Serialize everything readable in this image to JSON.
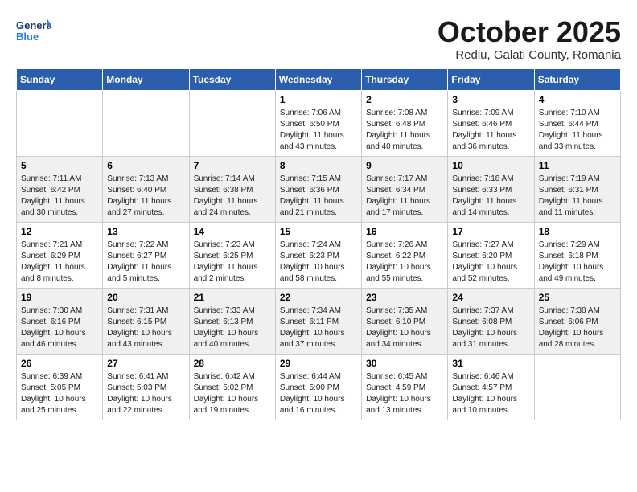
{
  "header": {
    "logo_text_general": "General",
    "logo_text_blue": "Blue",
    "month": "October 2025",
    "location": "Rediu, Galati County, Romania"
  },
  "weekdays": [
    "Sunday",
    "Monday",
    "Tuesday",
    "Wednesday",
    "Thursday",
    "Friday",
    "Saturday"
  ],
  "weeks": [
    [
      {
        "day": "",
        "info": ""
      },
      {
        "day": "",
        "info": ""
      },
      {
        "day": "",
        "info": ""
      },
      {
        "day": "1",
        "info": "Sunrise: 7:06 AM\nSunset: 6:50 PM\nDaylight: 11 hours\nand 43 minutes."
      },
      {
        "day": "2",
        "info": "Sunrise: 7:08 AM\nSunset: 6:48 PM\nDaylight: 11 hours\nand 40 minutes."
      },
      {
        "day": "3",
        "info": "Sunrise: 7:09 AM\nSunset: 6:46 PM\nDaylight: 11 hours\nand 36 minutes."
      },
      {
        "day": "4",
        "info": "Sunrise: 7:10 AM\nSunset: 6:44 PM\nDaylight: 11 hours\nand 33 minutes."
      }
    ],
    [
      {
        "day": "5",
        "info": "Sunrise: 7:11 AM\nSunset: 6:42 PM\nDaylight: 11 hours\nand 30 minutes."
      },
      {
        "day": "6",
        "info": "Sunrise: 7:13 AM\nSunset: 6:40 PM\nDaylight: 11 hours\nand 27 minutes."
      },
      {
        "day": "7",
        "info": "Sunrise: 7:14 AM\nSunset: 6:38 PM\nDaylight: 11 hours\nand 24 minutes."
      },
      {
        "day": "8",
        "info": "Sunrise: 7:15 AM\nSunset: 6:36 PM\nDaylight: 11 hours\nand 21 minutes."
      },
      {
        "day": "9",
        "info": "Sunrise: 7:17 AM\nSunset: 6:34 PM\nDaylight: 11 hours\nand 17 minutes."
      },
      {
        "day": "10",
        "info": "Sunrise: 7:18 AM\nSunset: 6:33 PM\nDaylight: 11 hours\nand 14 minutes."
      },
      {
        "day": "11",
        "info": "Sunrise: 7:19 AM\nSunset: 6:31 PM\nDaylight: 11 hours\nand 11 minutes."
      }
    ],
    [
      {
        "day": "12",
        "info": "Sunrise: 7:21 AM\nSunset: 6:29 PM\nDaylight: 11 hours\nand 8 minutes."
      },
      {
        "day": "13",
        "info": "Sunrise: 7:22 AM\nSunset: 6:27 PM\nDaylight: 11 hours\nand 5 minutes."
      },
      {
        "day": "14",
        "info": "Sunrise: 7:23 AM\nSunset: 6:25 PM\nDaylight: 11 hours\nand 2 minutes."
      },
      {
        "day": "15",
        "info": "Sunrise: 7:24 AM\nSunset: 6:23 PM\nDaylight: 10 hours\nand 58 minutes."
      },
      {
        "day": "16",
        "info": "Sunrise: 7:26 AM\nSunset: 6:22 PM\nDaylight: 10 hours\nand 55 minutes."
      },
      {
        "day": "17",
        "info": "Sunrise: 7:27 AM\nSunset: 6:20 PM\nDaylight: 10 hours\nand 52 minutes."
      },
      {
        "day": "18",
        "info": "Sunrise: 7:29 AM\nSunset: 6:18 PM\nDaylight: 10 hours\nand 49 minutes."
      }
    ],
    [
      {
        "day": "19",
        "info": "Sunrise: 7:30 AM\nSunset: 6:16 PM\nDaylight: 10 hours\nand 46 minutes."
      },
      {
        "day": "20",
        "info": "Sunrise: 7:31 AM\nSunset: 6:15 PM\nDaylight: 10 hours\nand 43 minutes."
      },
      {
        "day": "21",
        "info": "Sunrise: 7:33 AM\nSunset: 6:13 PM\nDaylight: 10 hours\nand 40 minutes."
      },
      {
        "day": "22",
        "info": "Sunrise: 7:34 AM\nSunset: 6:11 PM\nDaylight: 10 hours\nand 37 minutes."
      },
      {
        "day": "23",
        "info": "Sunrise: 7:35 AM\nSunset: 6:10 PM\nDaylight: 10 hours\nand 34 minutes."
      },
      {
        "day": "24",
        "info": "Sunrise: 7:37 AM\nSunset: 6:08 PM\nDaylight: 10 hours\nand 31 minutes."
      },
      {
        "day": "25",
        "info": "Sunrise: 7:38 AM\nSunset: 6:06 PM\nDaylight: 10 hours\nand 28 minutes."
      }
    ],
    [
      {
        "day": "26",
        "info": "Sunrise: 6:39 AM\nSunset: 5:05 PM\nDaylight: 10 hours\nand 25 minutes."
      },
      {
        "day": "27",
        "info": "Sunrise: 6:41 AM\nSunset: 5:03 PM\nDaylight: 10 hours\nand 22 minutes."
      },
      {
        "day": "28",
        "info": "Sunrise: 6:42 AM\nSunset: 5:02 PM\nDaylight: 10 hours\nand 19 minutes."
      },
      {
        "day": "29",
        "info": "Sunrise: 6:44 AM\nSunset: 5:00 PM\nDaylight: 10 hours\nand 16 minutes."
      },
      {
        "day": "30",
        "info": "Sunrise: 6:45 AM\nSunset: 4:59 PM\nDaylight: 10 hours\nand 13 minutes."
      },
      {
        "day": "31",
        "info": "Sunrise: 6:46 AM\nSunset: 4:57 PM\nDaylight: 10 hours\nand 10 minutes."
      },
      {
        "day": "",
        "info": ""
      }
    ]
  ]
}
